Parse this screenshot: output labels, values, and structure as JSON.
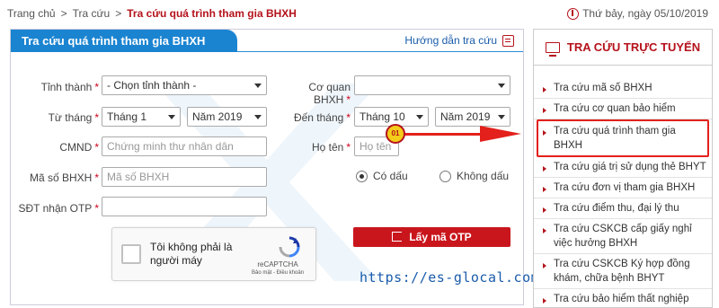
{
  "breadcrumb": {
    "home": "Trang chủ",
    "sep": ">",
    "parent": "Tra cứu",
    "current": "Tra cứu quá trình tham gia BHXH"
  },
  "date_text": "Thứ bảy, ngày 05/10/2019",
  "main": {
    "title": "Tra cứu quá trình tham gia BHXH",
    "guide_link": "Hướng dẫn tra cứu"
  },
  "form": {
    "province_label": "Tỉnh thành",
    "province_value": "- Chọn tỉnh thành -",
    "agency_label": "Cơ quan BHXH",
    "agency_value": "",
    "from_label": "Từ tháng",
    "from_month": "Tháng 1",
    "from_year": "Năm 2019",
    "to_label": "Đến tháng",
    "to_month": "Tháng 10",
    "to_year": "Năm 2019",
    "id_label": "CMND",
    "id_placeholder": "Chứng minh thư nhân dân",
    "name_label": "Họ tên",
    "name_placeholder": "Họ tên",
    "code_label": "Mã số BHXH",
    "code_placeholder": "Mã số BHXH",
    "accent_on": "Có dấu",
    "accent_off": "Không dấu",
    "phone_label": "SĐT nhận OTP",
    "phone_value": "",
    "required_mark": "*",
    "captcha_text": "Tôi không phải là người máy",
    "captcha_brand": "reCAPTCHA",
    "captcha_links": "Bảo mật - Điều khoản",
    "otp_button": "Lấy mã OTP"
  },
  "annotation": {
    "step": "01",
    "site": "https://es-glocal.com/"
  },
  "sidebar": {
    "title": "TRA CỨU TRỰC TUYẾN",
    "items": [
      {
        "label": "Tra cứu mã số BHXH"
      },
      {
        "label": "Tra cứu cơ quan bảo hiểm"
      },
      {
        "label": "Tra cứu quá trình tham gia BHXH"
      },
      {
        "label": "Tra cứu giá trị sử dụng thẻ BHYT"
      },
      {
        "label": "Tra cứu đơn vị tham gia BHXH"
      },
      {
        "label": "Tra cứu điểm thu, đại lý thu"
      },
      {
        "label": "Tra cứu CSKCB cấp giấy nghỉ việc hưởng BHXH"
      },
      {
        "label": "Tra cứu CSKCB Ký hợp đồng khám, chữa bệnh BHYT"
      },
      {
        "label": "Tra cứu bảo hiểm thất nghiệp"
      }
    ]
  },
  "colors": {
    "brand_blue": "#1b84d1",
    "brand_red": "#b5121b",
    "button_red": "#c9161d",
    "annotation_red": "#e3201b",
    "badge_yellow": "#f4cc1a"
  }
}
